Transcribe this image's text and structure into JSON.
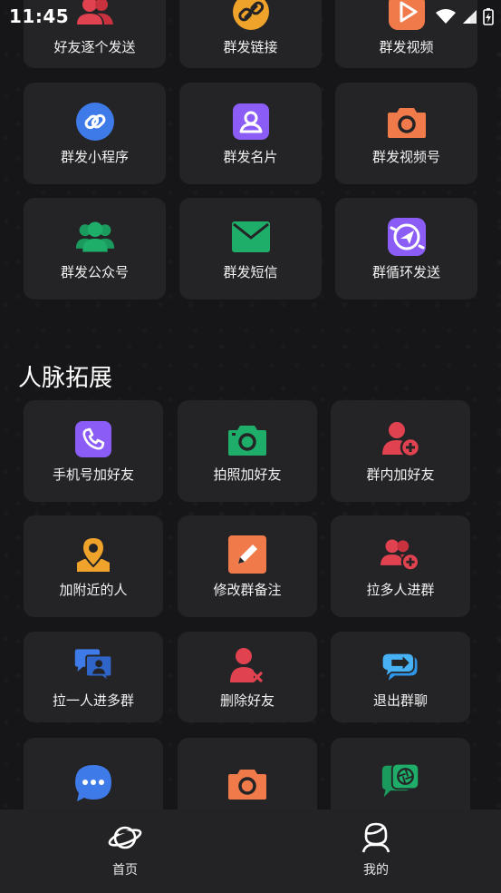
{
  "status_bar": {
    "time": "11:45"
  },
  "mass_send": {
    "items": [
      {
        "label": "好友逐个发送",
        "icon": "users-icon"
      },
      {
        "label": "群发链接",
        "icon": "link-icon"
      },
      {
        "label": "群发视频",
        "icon": "video-play-icon"
      },
      {
        "label": "群发小程序",
        "icon": "mini-program-icon"
      },
      {
        "label": "群发名片",
        "icon": "contact-card-icon"
      },
      {
        "label": "群发视频号",
        "icon": "camera-icon"
      },
      {
        "label": "群发公众号",
        "icon": "official-account-icon"
      },
      {
        "label": "群发短信",
        "icon": "envelope-icon"
      },
      {
        "label": "群循环发送",
        "icon": "cycle-send-icon"
      }
    ]
  },
  "network_section": {
    "title": "人脉拓展",
    "items": [
      {
        "label": "手机号加好友",
        "icon": "phone-icon"
      },
      {
        "label": "拍照加好友",
        "icon": "camera-icon"
      },
      {
        "label": "群内加好友",
        "icon": "user-add-icon"
      },
      {
        "label": "加附近的人",
        "icon": "location-pin-icon"
      },
      {
        "label": "修改群备注",
        "icon": "edit-pencil-icon"
      },
      {
        "label": "拉多人进群",
        "icon": "users-add-icon"
      },
      {
        "label": "拉一人进多群",
        "icon": "chat-user-icon"
      },
      {
        "label": "删除好友",
        "icon": "user-remove-icon"
      },
      {
        "label": "退出群聊",
        "icon": "exit-chat-icon"
      },
      {
        "label": "",
        "icon": "chat-bubble-dots-icon"
      },
      {
        "label": "",
        "icon": "camera-icon"
      },
      {
        "label": "",
        "icon": "chat-shutter-icon"
      }
    ]
  },
  "bottom_nav": {
    "items": [
      {
        "label": "首页",
        "icon": "planet-icon"
      },
      {
        "label": "我的",
        "icon": "profile-icon"
      }
    ]
  },
  "colors": {
    "background": "#161618",
    "tile": "#242427",
    "red": "#e0424f",
    "orange": "#f0a32a",
    "coral": "#f07a4a",
    "blue": "#3f7be8",
    "purple": "#8b5cf6",
    "green": "#1fae6a",
    "cyan": "#2f95e8"
  }
}
